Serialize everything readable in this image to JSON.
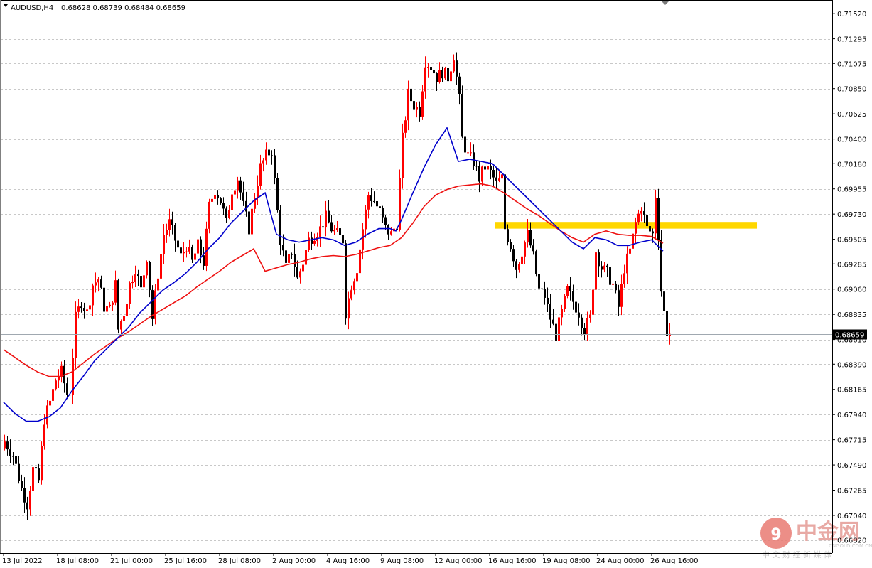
{
  "header": {
    "symbol": "AUDUSD,H4",
    "prices": "0.68628 0.68739 0.68484 0.68659"
  },
  "watermark": {
    "brand": "中金网",
    "tagline": "中 文 财 经 新 媒 体",
    "domain": "CNGOLD.COM.CN"
  },
  "colors": {
    "background": "#ffffff",
    "grid": "#c8c8c8",
    "bull": "#ff0000",
    "bear": "#000000",
    "ma_fast": "#0000cc",
    "ma_slow": "#ee1111",
    "resistance_band": "#ffd700",
    "price_tag": "#000000"
  },
  "chart_data": {
    "type": "candlestick",
    "symbol": "AUDUSD",
    "timeframe": "H4",
    "current_price": 0.68659,
    "current_price_label": "0.68659",
    "ylim": [
      0.6664,
      0.7154
    ],
    "y_ticks": [
      "0.71520",
      "0.71295",
      "0.71075",
      "0.70850",
      "0.70625",
      "0.70400",
      "0.70180",
      "0.69955",
      "0.69730",
      "0.69505",
      "0.69285",
      "0.69060",
      "0.68835",
      "0.68610",
      "0.68390",
      "0.68165",
      "0.67940",
      "0.67715",
      "0.67490",
      "0.67265",
      "0.67040",
      "0.66820"
    ],
    "x_ticks": [
      {
        "label": "13 Jul 2022",
        "bar": 0
      },
      {
        "label": "18 Jul 08:00",
        "bar": 19
      },
      {
        "label": "21 Jul 00:00",
        "bar": 38
      },
      {
        "label": "25 Jul 16:00",
        "bar": 57
      },
      {
        "label": "28 Jul 08:00",
        "bar": 76
      },
      {
        "label": "2 Aug 00:00",
        "bar": 95
      },
      {
        "label": "4 Aug 16:00",
        "bar": 114
      },
      {
        "label": "9 Aug 08:00",
        "bar": 133
      },
      {
        "label": "12 Aug 00:00",
        "bar": 152
      },
      {
        "label": "16 Aug 16:00",
        "bar": 171
      },
      {
        "label": "19 Aug 08:00",
        "bar": 190
      },
      {
        "label": "24 Aug 00:00",
        "bar": 209
      },
      {
        "label": "26 Aug 16:00",
        "bar": 228
      }
    ],
    "resistance_zone": {
      "from_bar": 173,
      "to_bar": 265,
      "low": 0.696,
      "high": 0.6966
    },
    "close_path": [
      [
        0,
        0.677
      ],
      [
        3,
        0.6758
      ],
      [
        6,
        0.6728
      ],
      [
        8,
        0.6714
      ],
      [
        10,
        0.6745
      ],
      [
        12,
        0.6735
      ],
      [
        14,
        0.679
      ],
      [
        16,
        0.6805
      ],
      [
        18,
        0.6825
      ],
      [
        20,
        0.6832
      ],
      [
        22,
        0.6812
      ],
      [
        23,
        0.6815
      ],
      [
        25,
        0.688
      ],
      [
        27,
        0.6895
      ],
      [
        29,
        0.6885
      ],
      [
        31,
        0.691
      ],
      [
        33,
        0.6915
      ],
      [
        35,
        0.689
      ],
      [
        37,
        0.6888
      ],
      [
        39,
        0.691
      ],
      [
        40,
        0.687
      ],
      [
        42,
        0.6885
      ],
      [
        44,
        0.691
      ],
      [
        46,
        0.6925
      ],
      [
        48,
        0.6905
      ],
      [
        50,
        0.6935
      ],
      [
        52,
        0.688
      ],
      [
        54,
        0.692
      ],
      [
        56,
        0.6955
      ],
      [
        58,
        0.6965
      ],
      [
        60,
        0.695
      ],
      [
        62,
        0.6935
      ],
      [
        64,
        0.6945
      ],
      [
        66,
        0.693
      ],
      [
        68,
        0.6945
      ],
      [
        70,
        0.693
      ],
      [
        72,
        0.698
      ],
      [
        74,
        0.6995
      ],
      [
        76,
        0.6985
      ],
      [
        78,
        0.6965
      ],
      [
        80,
        0.6995
      ],
      [
        82,
        0.7005
      ],
      [
        84,
        0.698
      ],
      [
        86,
        0.696
      ],
      [
        88,
        0.699
      ],
      [
        90,
        0.7015
      ],
      [
        92,
        0.7025
      ],
      [
        94,
        0.703
      ],
      [
        96,
        0.6975
      ],
      [
        97,
        0.695
      ],
      [
        99,
        0.6925
      ],
      [
        101,
        0.694
      ],
      [
        103,
        0.6915
      ],
      [
        105,
        0.693
      ],
      [
        107,
        0.695
      ],
      [
        109,
        0.6955
      ],
      [
        111,
        0.696
      ],
      [
        113,
        0.697
      ],
      [
        115,
        0.696
      ],
      [
        117,
        0.6955
      ],
      [
        119,
        0.695
      ],
      [
        120,
        0.6885
      ],
      [
        122,
        0.691
      ],
      [
        124,
        0.6925
      ],
      [
        126,
        0.696
      ],
      [
        128,
        0.699
      ],
      [
        130,
        0.6985
      ],
      [
        132,
        0.6975
      ],
      [
        134,
        0.696
      ],
      [
        136,
        0.6955
      ],
      [
        138,
        0.6965
      ],
      [
        140,
        0.704
      ],
      [
        142,
        0.708
      ],
      [
        144,
        0.707
      ],
      [
        146,
        0.7065
      ],
      [
        148,
        0.711
      ],
      [
        150,
        0.7105
      ],
      [
        152,
        0.7095
      ],
      [
        154,
        0.71
      ],
      [
        156,
        0.7095
      ],
      [
        158,
        0.7115
      ],
      [
        160,
        0.7075
      ],
      [
        161,
        0.704
      ],
      [
        163,
        0.7025
      ],
      [
        165,
        0.702
      ],
      [
        167,
        0.7005
      ],
      [
        169,
        0.7015
      ],
      [
        171,
        0.701
      ],
      [
        173,
        0.7
      ],
      [
        175,
        0.7005
      ],
      [
        176,
        0.696
      ],
      [
        178,
        0.6945
      ],
      [
        180,
        0.6925
      ],
      [
        182,
        0.694
      ],
      [
        184,
        0.6955
      ],
      [
        186,
        0.6935
      ],
      [
        188,
        0.6905
      ],
      [
        190,
        0.69
      ],
      [
        192,
        0.688
      ],
      [
        194,
        0.6865
      ],
      [
        196,
        0.6885
      ],
      [
        198,
        0.6905
      ],
      [
        200,
        0.6895
      ],
      [
        202,
        0.6885
      ],
      [
        204,
        0.687
      ],
      [
        206,
        0.688
      ],
      [
        208,
        0.694
      ],
      [
        210,
        0.6925
      ],
      [
        212,
        0.692
      ],
      [
        214,
        0.691
      ],
      [
        216,
        0.689
      ],
      [
        218,
        0.6925
      ],
      [
        220,
        0.694
      ],
      [
        222,
        0.6965
      ],
      [
        224,
        0.698
      ],
      [
        226,
        0.696
      ],
      [
        228,
        0.6955
      ],
      [
        229,
        0.699
      ],
      [
        230,
        0.6955
      ],
      [
        231,
        0.6905
      ],
      [
        232,
        0.6885
      ],
      [
        233,
        0.6868
      ],
      [
        234,
        0.6866
      ]
    ],
    "ma_fast": [
      [
        0,
        0.6805
      ],
      [
        4,
        0.6795
      ],
      [
        8,
        0.6788
      ],
      [
        12,
        0.6788
      ],
      [
        16,
        0.6792
      ],
      [
        20,
        0.68
      ],
      [
        24,
        0.6815
      ],
      [
        28,
        0.6828
      ],
      [
        32,
        0.6842
      ],
      [
        36,
        0.6852
      ],
      [
        40,
        0.6862
      ],
      [
        44,
        0.6872
      ],
      [
        48,
        0.6885
      ],
      [
        52,
        0.6895
      ],
      [
        56,
        0.6905
      ],
      [
        60,
        0.6912
      ],
      [
        64,
        0.692
      ],
      [
        68,
        0.693
      ],
      [
        72,
        0.6942
      ],
      [
        76,
        0.6952
      ],
      [
        80,
        0.6965
      ],
      [
        84,
        0.6975
      ],
      [
        88,
        0.6985
      ],
      [
        92,
        0.6992
      ],
      [
        96,
        0.6955
      ],
      [
        100,
        0.695
      ],
      [
        104,
        0.6948
      ],
      [
        108,
        0.695
      ],
      [
        112,
        0.6952
      ],
      [
        116,
        0.695
      ],
      [
        120,
        0.6945
      ],
      [
        124,
        0.6948
      ],
      [
        128,
        0.6955
      ],
      [
        132,
        0.696
      ],
      [
        136,
        0.696
      ],
      [
        138,
        0.6958
      ],
      [
        140,
        0.6968
      ],
      [
        144,
        0.6992
      ],
      [
        148,
        0.7015
      ],
      [
        152,
        0.7035
      ],
      [
        156,
        0.705
      ],
      [
        160,
        0.702
      ],
      [
        164,
        0.7022
      ],
      [
        168,
        0.702
      ],
      [
        172,
        0.7018
      ],
      [
        176,
        0.7008
      ],
      [
        180,
        0.6998
      ],
      [
        184,
        0.6988
      ],
      [
        188,
        0.6978
      ],
      [
        192,
        0.6968
      ],
      [
        196,
        0.6958
      ],
      [
        200,
        0.6948
      ],
      [
        204,
        0.6942
      ],
      [
        208,
        0.6952
      ],
      [
        212,
        0.695
      ],
      [
        216,
        0.6945
      ],
      [
        220,
        0.6945
      ],
      [
        224,
        0.6948
      ],
      [
        228,
        0.695
      ],
      [
        232,
        0.694
      ]
    ],
    "ma_slow": [
      [
        0,
        0.6852
      ],
      [
        4,
        0.6845
      ],
      [
        8,
        0.6838
      ],
      [
        12,
        0.6832
      ],
      [
        16,
        0.6828
      ],
      [
        20,
        0.6828
      ],
      [
        24,
        0.6832
      ],
      [
        28,
        0.684
      ],
      [
        32,
        0.6848
      ],
      [
        36,
        0.6855
      ],
      [
        40,
        0.6862
      ],
      [
        44,
        0.6868
      ],
      [
        48,
        0.6875
      ],
      [
        52,
        0.6882
      ],
      [
        56,
        0.6888
      ],
      [
        60,
        0.6894
      ],
      [
        64,
        0.69
      ],
      [
        68,
        0.6908
      ],
      [
        72,
        0.6915
      ],
      [
        76,
        0.6922
      ],
      [
        80,
        0.693
      ],
      [
        84,
        0.6936
      ],
      [
        88,
        0.6942
      ],
      [
        92,
        0.6922
      ],
      [
        96,
        0.6925
      ],
      [
        100,
        0.6928
      ],
      [
        104,
        0.693
      ],
      [
        108,
        0.6933
      ],
      [
        112,
        0.6935
      ],
      [
        116,
        0.6936
      ],
      [
        120,
        0.6935
      ],
      [
        124,
        0.6937
      ],
      [
        128,
        0.694
      ],
      [
        132,
        0.6943
      ],
      [
        136,
        0.6945
      ],
      [
        140,
        0.6952
      ],
      [
        144,
        0.6965
      ],
      [
        148,
        0.698
      ],
      [
        152,
        0.699
      ],
      [
        156,
        0.6995
      ],
      [
        160,
        0.6998
      ],
      [
        164,
        0.6999
      ],
      [
        168,
        0.7
      ],
      [
        172,
        0.6998
      ],
      [
        176,
        0.6992
      ],
      [
        180,
        0.6985
      ],
      [
        184,
        0.6978
      ],
      [
        188,
        0.6972
      ],
      [
        192,
        0.6965
      ],
      [
        196,
        0.6958
      ],
      [
        200,
        0.6952
      ],
      [
        204,
        0.6948
      ],
      [
        208,
        0.6955
      ],
      [
        212,
        0.6958
      ],
      [
        216,
        0.6955
      ],
      [
        220,
        0.6954
      ],
      [
        224,
        0.6954
      ],
      [
        228,
        0.6953
      ],
      [
        232,
        0.6947
      ]
    ]
  }
}
